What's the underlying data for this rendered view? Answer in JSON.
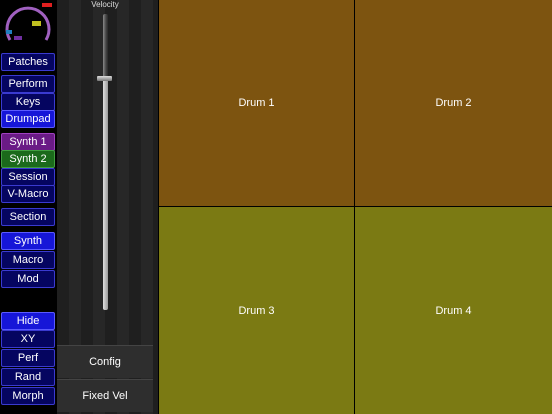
{
  "nav": {
    "buttons": [
      {
        "label": "Patches",
        "style": "normal"
      },
      {
        "label": "Perform",
        "style": "normal"
      },
      {
        "label": "Keys",
        "style": "normal"
      },
      {
        "label": "Drumpad",
        "style": "active"
      },
      {
        "label": "Synth 1",
        "style": "purple"
      },
      {
        "label": "Synth 2",
        "style": "green"
      },
      {
        "label": "Session",
        "style": "normal"
      },
      {
        "label": "V-Macro",
        "style": "normal"
      },
      {
        "label": "Section",
        "style": "normal"
      },
      {
        "label": "Synth",
        "style": "active"
      },
      {
        "label": "Macro",
        "style": "normal"
      },
      {
        "label": "Mod",
        "style": "normal"
      },
      {
        "label": "Hide",
        "style": "active"
      },
      {
        "label": "XY",
        "style": "normal"
      },
      {
        "label": "Perf",
        "style": "normal"
      },
      {
        "label": "Rand",
        "style": "normal"
      },
      {
        "label": "Morph",
        "style": "normal"
      }
    ]
  },
  "velocity": {
    "title": "Velocity",
    "level": 0.78,
    "config_label": "Config",
    "fixed_vel_label": "Fixed Vel"
  },
  "pads": [
    {
      "label": "Drum 1",
      "color": "#7d5410"
    },
    {
      "label": "Drum 2",
      "color": "#7d5410"
    },
    {
      "label": "Drum 3",
      "color": "#7b7a13"
    },
    {
      "label": "Drum 4",
      "color": "#7b7a13"
    }
  ],
  "colors": {
    "gauge_arc": "#a060c0",
    "gauge_marker_red": "#e02020",
    "gauge_marker_yellow": "#c0c020",
    "gauge_marker_blue": "#2080c0"
  }
}
